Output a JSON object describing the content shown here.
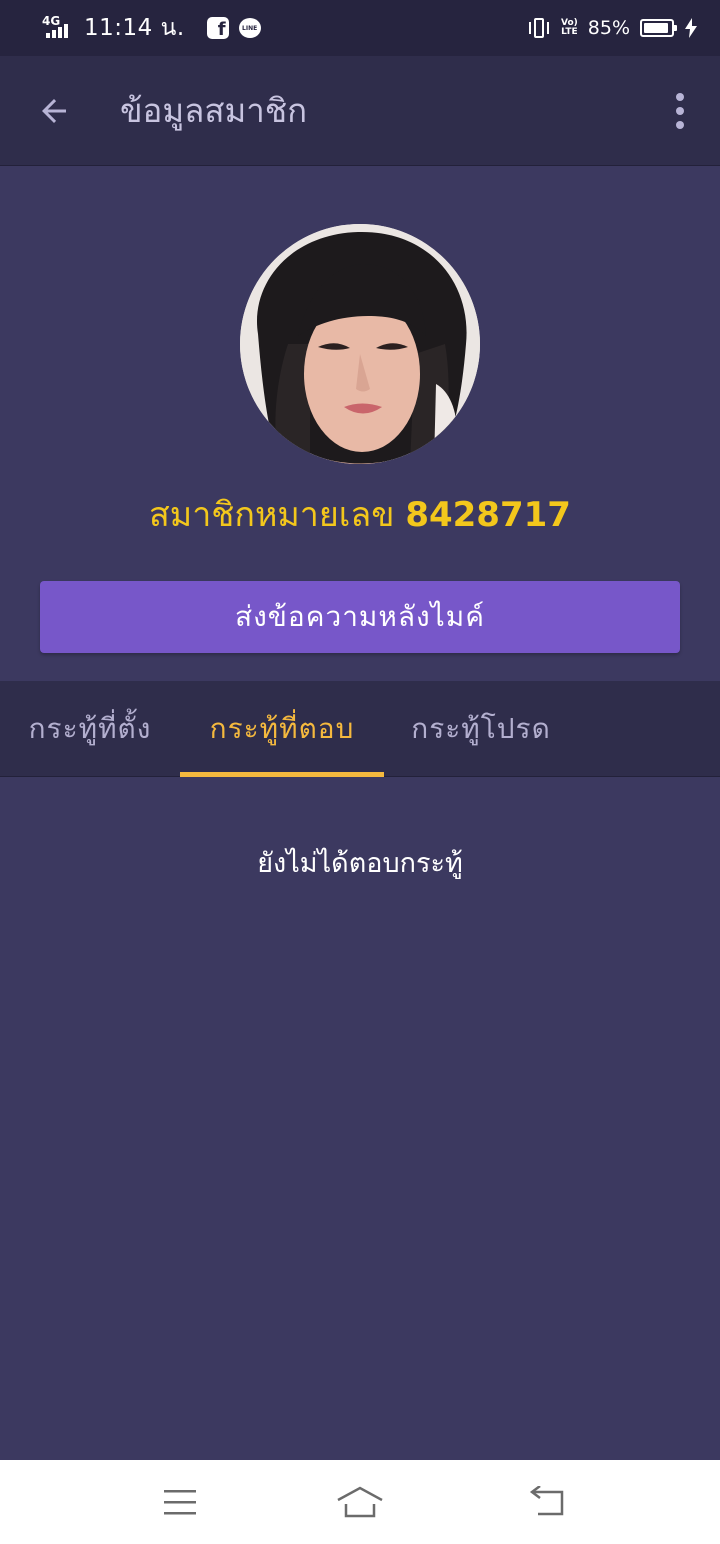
{
  "status_bar": {
    "network": "4G",
    "time": "11:14 น.",
    "volte": "Vo) LTE",
    "battery_percent": "85%",
    "icons": [
      "signal-icon",
      "facebook-icon",
      "line-icon",
      "vibrate-icon",
      "volte-icon",
      "battery-icon",
      "charging-icon"
    ]
  },
  "app_bar": {
    "title": "ข้อมูลสมาชิก",
    "icons": [
      "back-arrow-icon",
      "more-vert-icon"
    ]
  },
  "profile": {
    "member_prefix": "สมาชิกหมายเลข",
    "member_number": "8428717",
    "message_button": "ส่งข้อความหลังไมค์",
    "avatar": "profile-photo"
  },
  "tabs": [
    {
      "label": "กระทู้ที่ตั้ง",
      "active": false
    },
    {
      "label": "กระทู้ที่ตอบ",
      "active": true
    },
    {
      "label": "กระทู้โปรด",
      "active": false
    }
  ],
  "content": {
    "empty_message": "ยังไม่ได้ตอบกระทู้"
  },
  "nav_bar": {
    "icons": [
      "menu-icon",
      "home-icon",
      "back-icon"
    ]
  },
  "colors": {
    "background": "#3c3960",
    "bar": "#2f2d4b",
    "status_bar": "#26243f",
    "accent_yellow": "#f3c71c",
    "tab_active": "#f5b93e",
    "button": "#7757c9"
  }
}
